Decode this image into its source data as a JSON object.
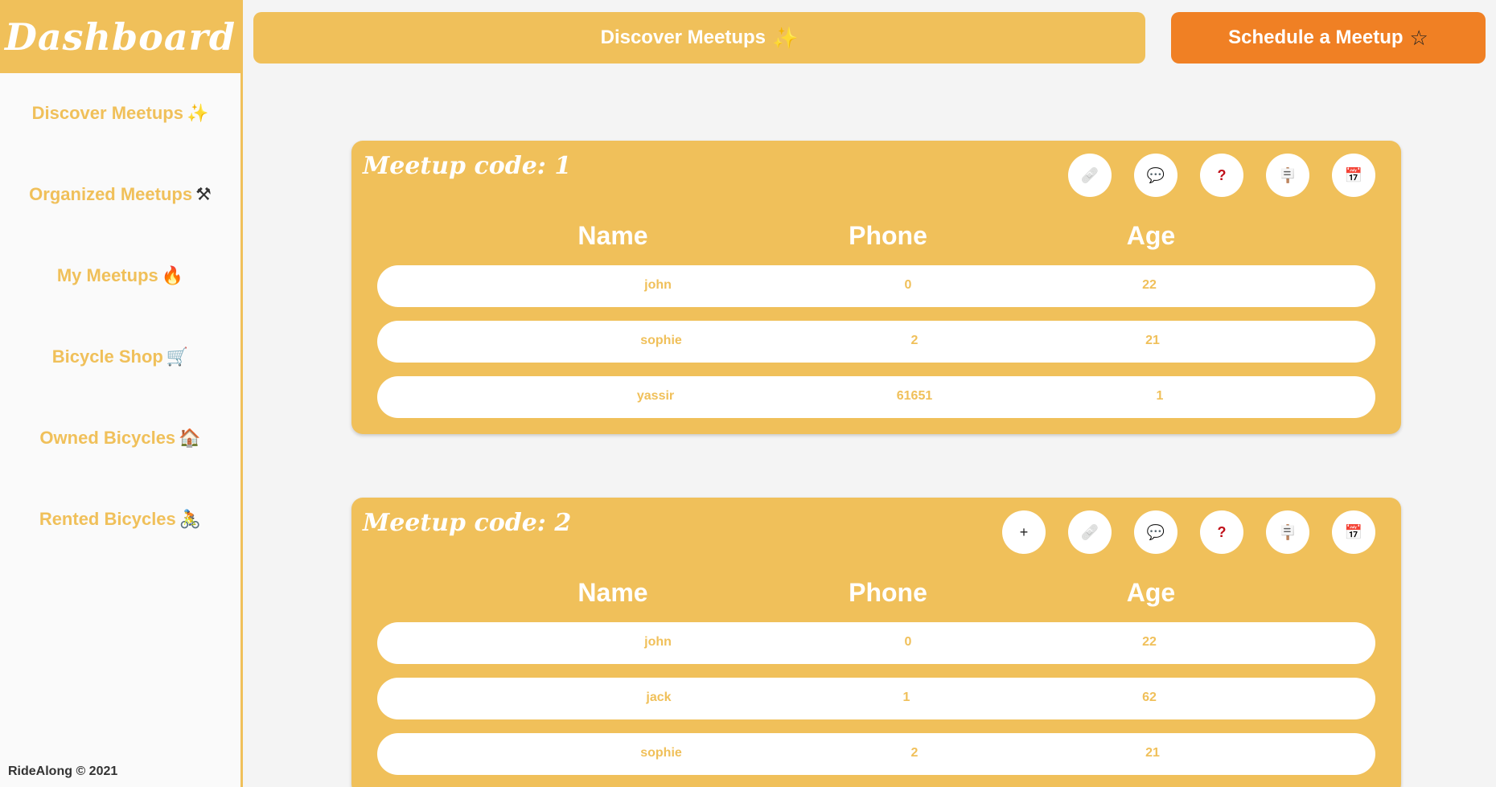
{
  "sidebar": {
    "brand": "Dashboard",
    "items": [
      {
        "label": "Discover Meetups",
        "emoji": "✨"
      },
      {
        "label": "Organized Meetups",
        "emoji": "⚒"
      },
      {
        "label": "My Meetups",
        "emoji": "🔥"
      },
      {
        "label": "Bicycle Shop",
        "emoji": "🛒"
      },
      {
        "label": "Owned Bicycles",
        "emoji": "🏠"
      },
      {
        "label": "Rented Bicycles",
        "emoji": "🚴"
      }
    ],
    "footer": "RideAlong © 2021"
  },
  "topbar": {
    "discover": {
      "label": "Discover Meetups",
      "emoji": "✨"
    },
    "schedule": {
      "label": "Schedule a Meetup",
      "emoji": "☆"
    }
  },
  "table_headers": [
    "Name",
    "Phone",
    "Age"
  ],
  "meetups": [
    {
      "title": "Meetup code: 1",
      "actions": [
        {
          "icon": "bandage-icon",
          "glyph": "🩹"
        },
        {
          "icon": "comment-icon",
          "glyph": "💬"
        },
        {
          "icon": "question-icon",
          "glyph": "?"
        },
        {
          "icon": "sign-icon",
          "glyph": "🪧"
        },
        {
          "icon": "calendar-icon",
          "glyph": "📅"
        }
      ],
      "rows": [
        {
          "name": "john",
          "phone": "0",
          "age": "22"
        },
        {
          "name": "sophie",
          "phone": "2",
          "age": "21"
        },
        {
          "name": "yassir",
          "phone": "61651",
          "age": "1"
        }
      ]
    },
    {
      "title": "Meetup code: 2",
      "actions": [
        {
          "icon": "plus-icon",
          "glyph": "+"
        },
        {
          "icon": "bandage-icon",
          "glyph": "🩹"
        },
        {
          "icon": "comment-icon",
          "glyph": "💬"
        },
        {
          "icon": "question-icon",
          "glyph": "?"
        },
        {
          "icon": "sign-icon",
          "glyph": "🪧"
        },
        {
          "icon": "calendar-icon",
          "glyph": "📅"
        }
      ],
      "rows": [
        {
          "name": "john",
          "phone": "0",
          "age": "22"
        },
        {
          "name": "jack",
          "phone": "1",
          "age": "62"
        },
        {
          "name": "sophie",
          "phone": "2",
          "age": "21"
        }
      ]
    }
  ],
  "colors": {
    "primary": "#f0c05a",
    "accent": "#f08024",
    "background": "#f4f4f4"
  }
}
